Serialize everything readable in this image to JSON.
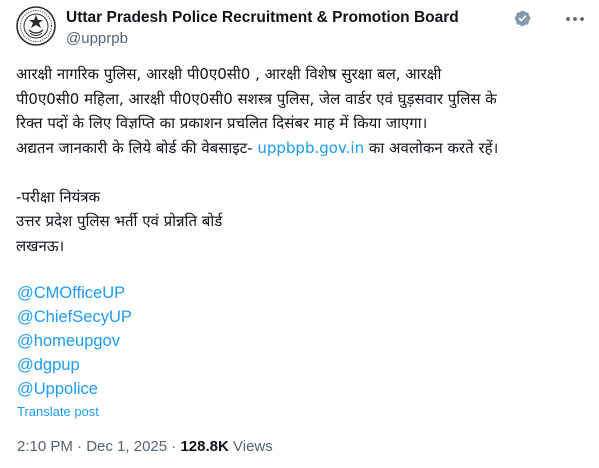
{
  "account": {
    "name": "Uttar Pradesh Police Recruitment & Promotion Board",
    "handle": "@upprpb",
    "verified_color": "#829aab"
  },
  "post": {
    "lines": [
      "आरक्षी नागरिक पुलिस, आरक्षी पी0ए0सी0 , आरक्षी विशेष सुरक्षा बल, आरक्षी",
      "पी0ए0सी0 महिला, आरक्षी पी0ए0सी0 सशस्त्र पुलिस, जेल वार्डर एवं घुड़सवार पुलिस के",
      "रिक्त पदों के लिए विज्ञप्ति का प्रकाशन प्रचलित दिसंबर माह में किया जाएगा।"
    ],
    "line4_before": "अद्यतन जानकारी के लिये बोर्ड की वेबसाइट- ",
    "link": "uppbpb.gov.in",
    "line4_after": "  का अवलोकन करते रहें।",
    "signature": [
      "-परीक्षा नियंत्रक",
      "उत्तर प्रदेश पुलिस भर्ती एवं प्रोन्नति बोर्ड",
      "लखनऊ।"
    ],
    "mentions": [
      "@CMOfficeUP",
      "@ChiefSecyUP",
      "@homeupgov",
      "@dgpup",
      "@Uppolice"
    ],
    "translate": "Translate post"
  },
  "meta": {
    "time": "2:10 PM",
    "date": "Dec 1, 2025",
    "views_count": "128.8K",
    "views_label": "Views"
  },
  "colors": {
    "link": "#1d9bf0",
    "text": "#0f1419",
    "secondary": "#536471"
  },
  "icons": {
    "avatar": "police-emblem-icon",
    "verified": "verified-badge-icon",
    "more": "more-options-icon"
  }
}
